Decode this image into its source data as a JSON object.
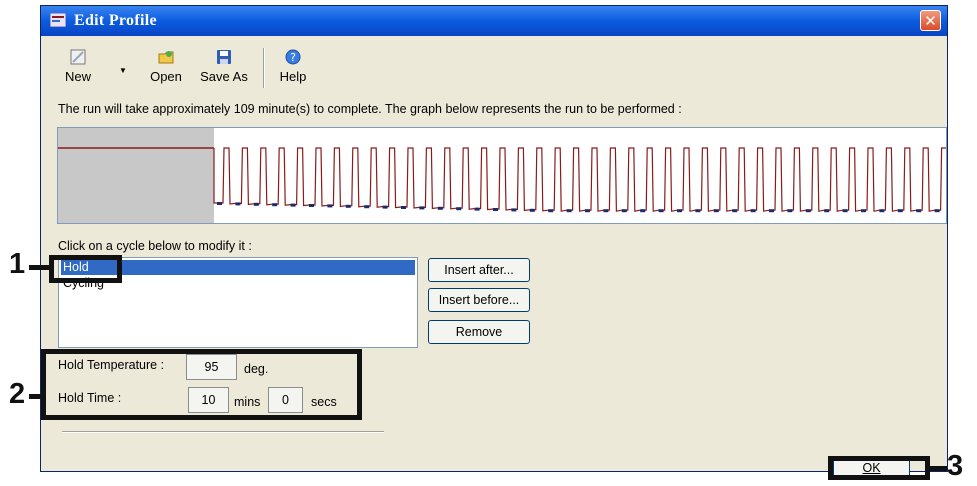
{
  "window": {
    "title": "Edit Profile",
    "close_symbol": "✕"
  },
  "toolbar": {
    "new_label": "New",
    "open_label": "Open",
    "save_as_label": "Save As",
    "help_label": "Help",
    "icons": [
      "new-icon",
      "open-icon",
      "save-icon",
      "help-icon"
    ]
  },
  "info_text": "The run will take approximately 109 minute(s) to complete. The graph below represents the run to be performed :",
  "graph": {
    "hold_color": "#8b1a1a",
    "cycle_count": 40
  },
  "cycle_prompt": "Click on a cycle below to modify it :",
  "cycles": [
    "Hold",
    "Cycling"
  ],
  "buttons": {
    "insert_after": "Insert after...",
    "insert_before": "Insert before...",
    "remove": "Remove",
    "ok": "OK"
  },
  "hold": {
    "temperature_label": "Hold Temperature :",
    "temperature_value": "95",
    "temperature_unit": "deg.",
    "time_label": "Hold Time :",
    "mins_value": "10",
    "mins_unit": "mins",
    "secs_value": "0",
    "secs_unit": "secs"
  },
  "callouts": [
    "1",
    "2",
    "3"
  ],
  "colors": {
    "titlebar": "#0b5ce0",
    "selection": "#316ac5",
    "window_bg": "#ece9d8"
  }
}
